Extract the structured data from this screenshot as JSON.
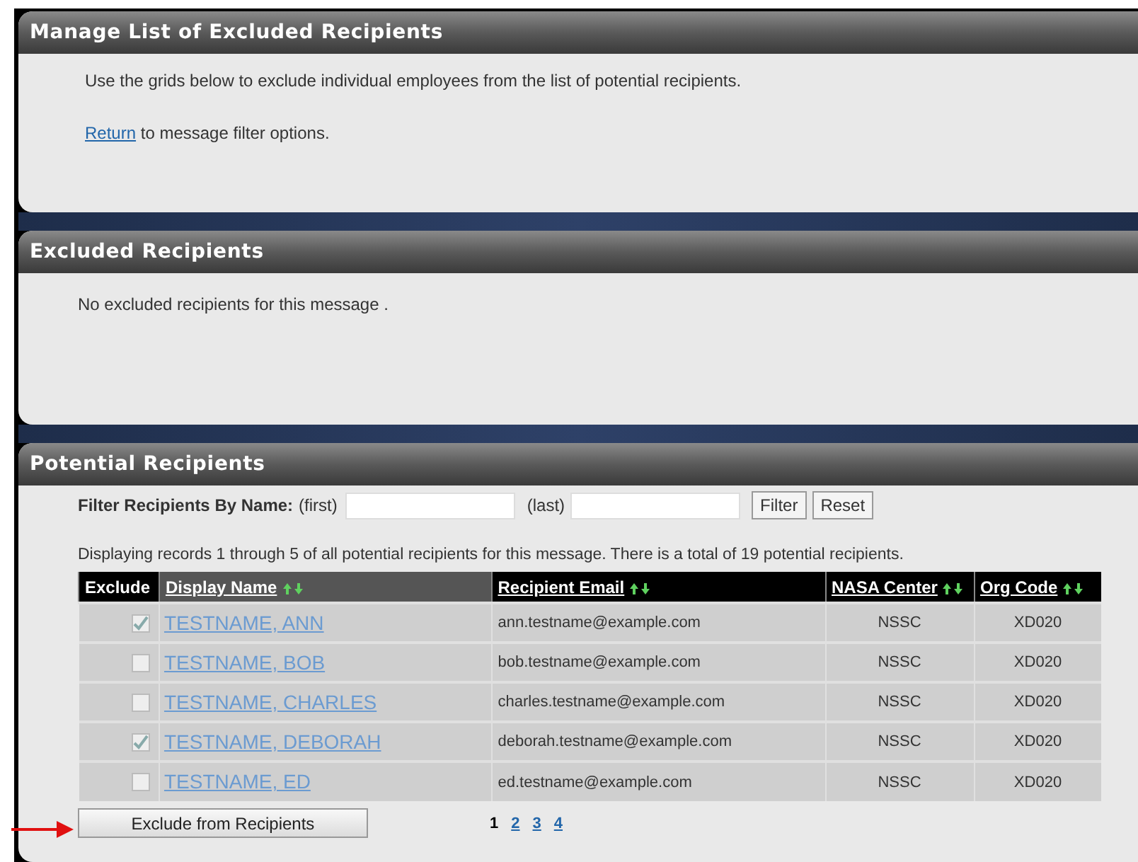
{
  "manage_panel": {
    "title": "Manage List of Excluded Recipients",
    "instructions": "Use the grids below to exclude individual employees from the list of potential recipients.",
    "return_link": "Return",
    "return_text": "to message filter options."
  },
  "excluded_panel": {
    "title": "Excluded Recipients",
    "empty_message": "No excluded recipients for this message ."
  },
  "potential_panel": {
    "title": "Potential Recipients",
    "filter_label": "Filter Recipients By Name:",
    "first_label": "(first)",
    "last_label": "(last)",
    "filter_button": "Filter",
    "reset_button": "Reset",
    "summary": "Displaying records 1 through 5 of all potential recipients for this message. There is a total of 19 potential recipients.",
    "table": {
      "columns": [
        {
          "label": "Exclude",
          "sortable": false
        },
        {
          "label": "Display Name",
          "sortable": true
        },
        {
          "label": "Recipient Email",
          "sortable": true
        },
        {
          "label": "NASA Center",
          "sortable": true
        },
        {
          "label": "Org Code",
          "sortable": true
        }
      ],
      "rows": [
        {
          "checked": true,
          "name": "TESTNAME, ANN",
          "email": "ann.testname@example.com",
          "center": "NSSC",
          "org": "XD020"
        },
        {
          "checked": false,
          "name": "TESTNAME, BOB",
          "email": "bob.testname@example.com",
          "center": "NSSC",
          "org": "XD020"
        },
        {
          "checked": false,
          "name": "TESTNAME, CHARLES",
          "email": "charles.testname@example.com",
          "center": "NSSC",
          "org": "XD020"
        },
        {
          "checked": true,
          "name": "TESTNAME, DEBORAH",
          "email": "deborah.testname@example.com",
          "center": "NSSC",
          "org": "XD020"
        },
        {
          "checked": false,
          "name": "TESTNAME, ED",
          "email": "ed.testname@example.com",
          "center": "NSSC",
          "org": "XD020"
        }
      ]
    },
    "exclude_button": "Exclude from Recipients",
    "pages": [
      {
        "label": "1",
        "selected": true
      },
      {
        "label": "2",
        "selected": false
      },
      {
        "label": "3",
        "selected": false
      },
      {
        "label": "4",
        "selected": false
      }
    ]
  }
}
